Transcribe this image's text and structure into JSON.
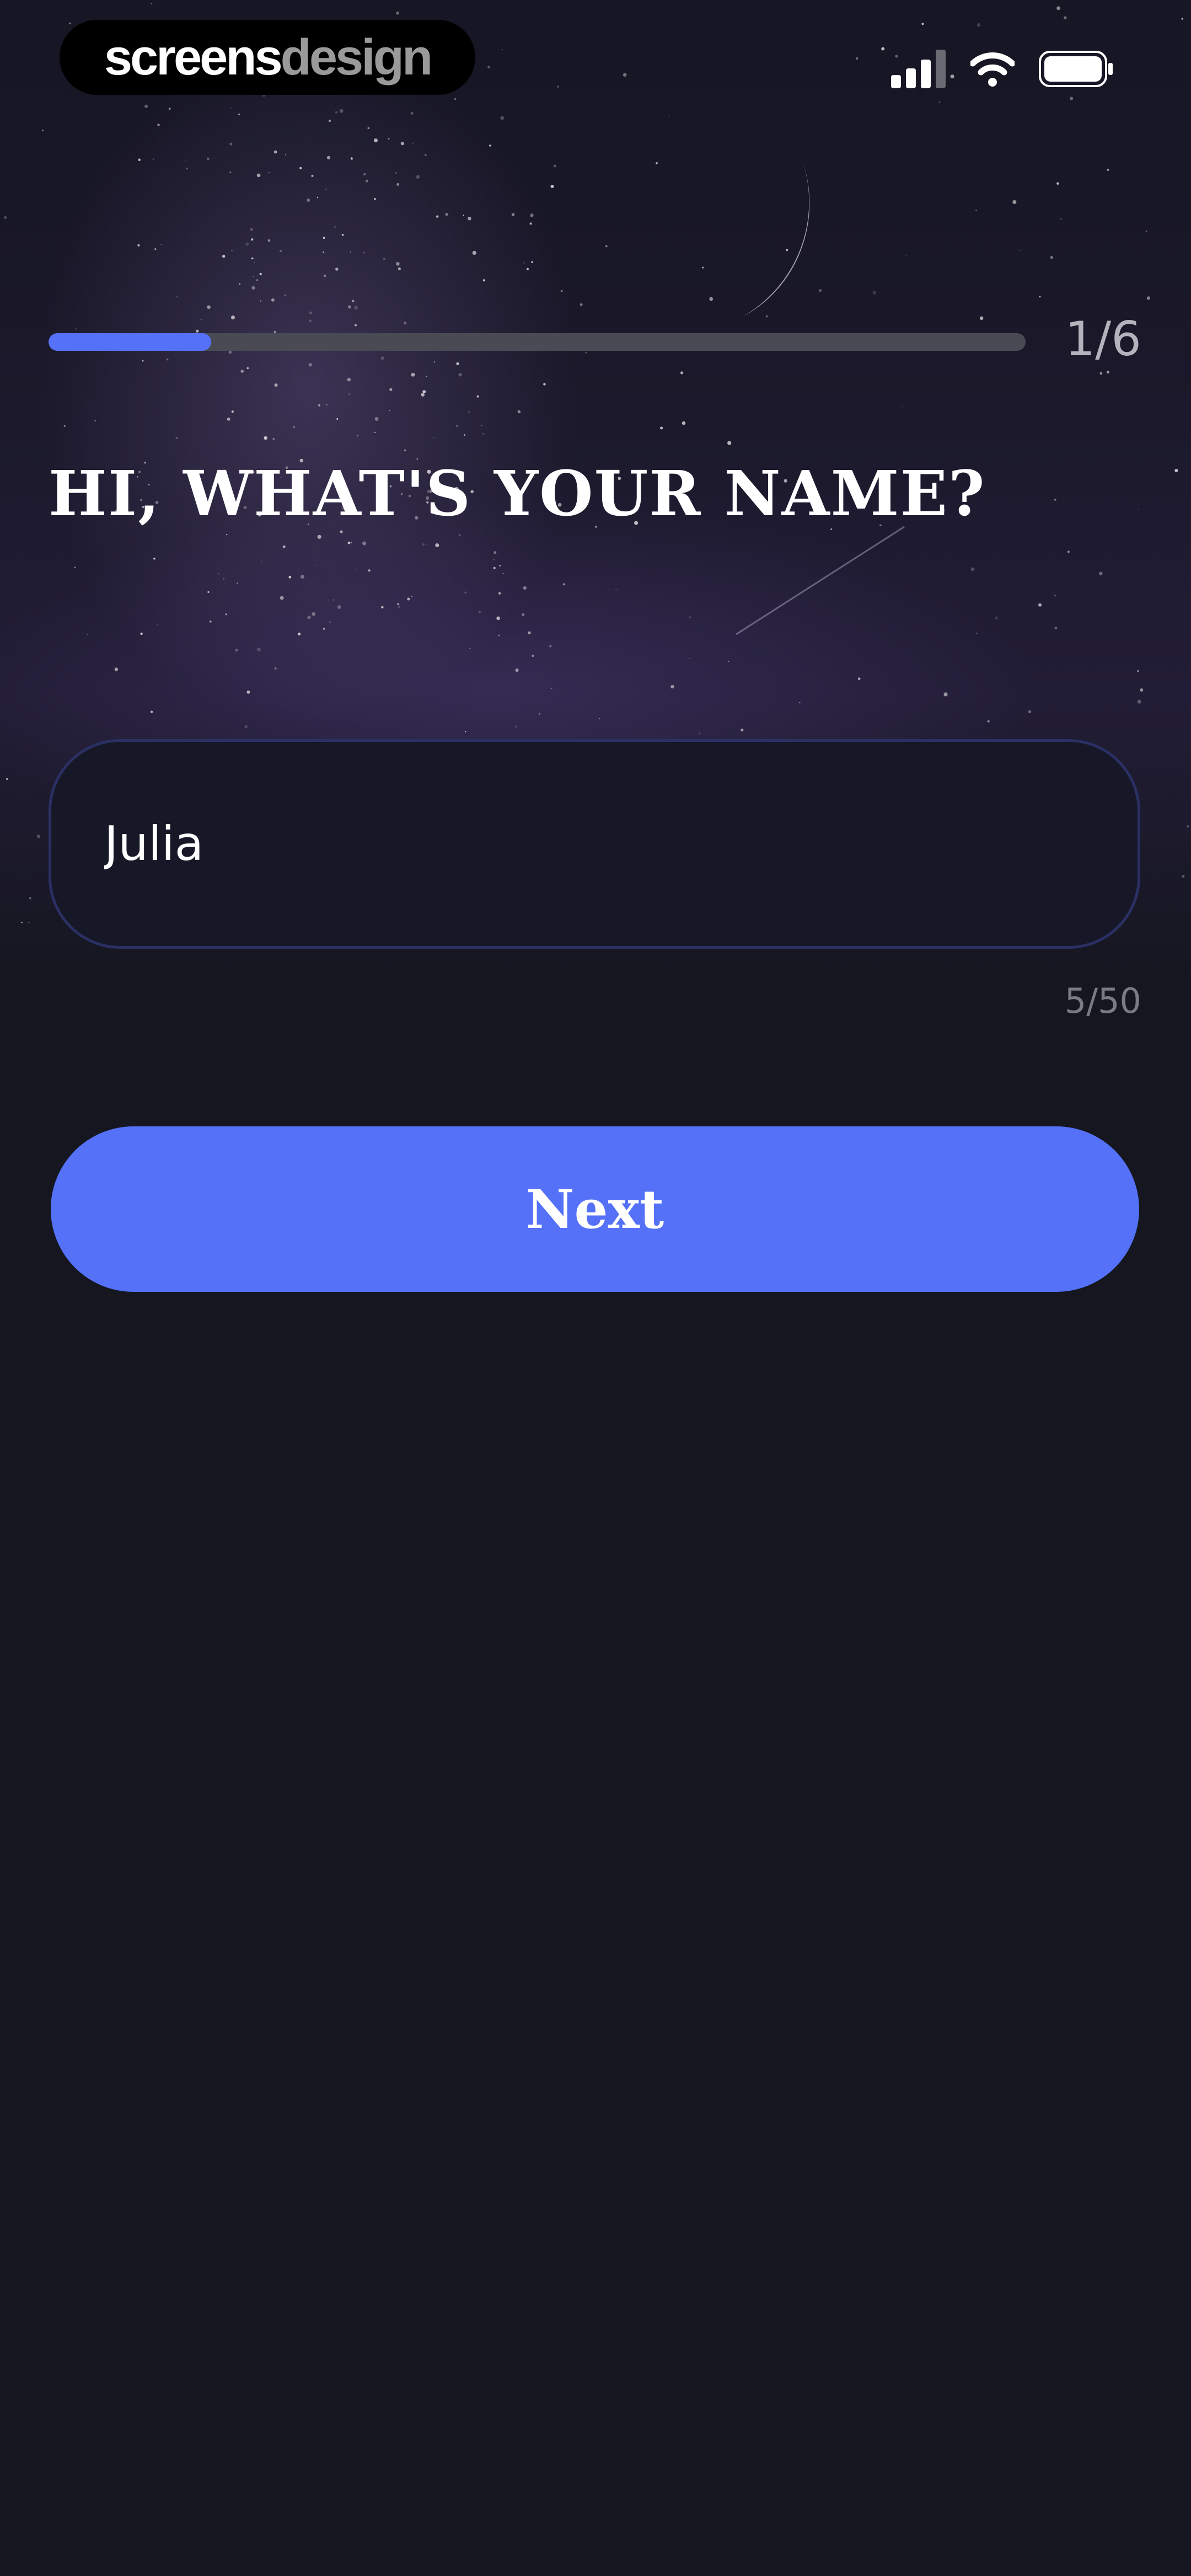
{
  "brand": {
    "part1": "screens",
    "part2": "design"
  },
  "status_bar": {
    "icons": [
      "signal-icon",
      "wifi-icon",
      "battery-icon"
    ]
  },
  "progress": {
    "current": 1,
    "total": 6,
    "fraction": 0.1667,
    "label": "1/6"
  },
  "title": "HI, WHAT'S YOUR NAME?",
  "name_field": {
    "value": "Julia",
    "char_count": "5/50"
  },
  "next_button": {
    "label": "Next"
  },
  "colors": {
    "accent": "#5471f7",
    "background": "#15161f",
    "field_border": "#2a3064",
    "track": "#4a4a55"
  }
}
